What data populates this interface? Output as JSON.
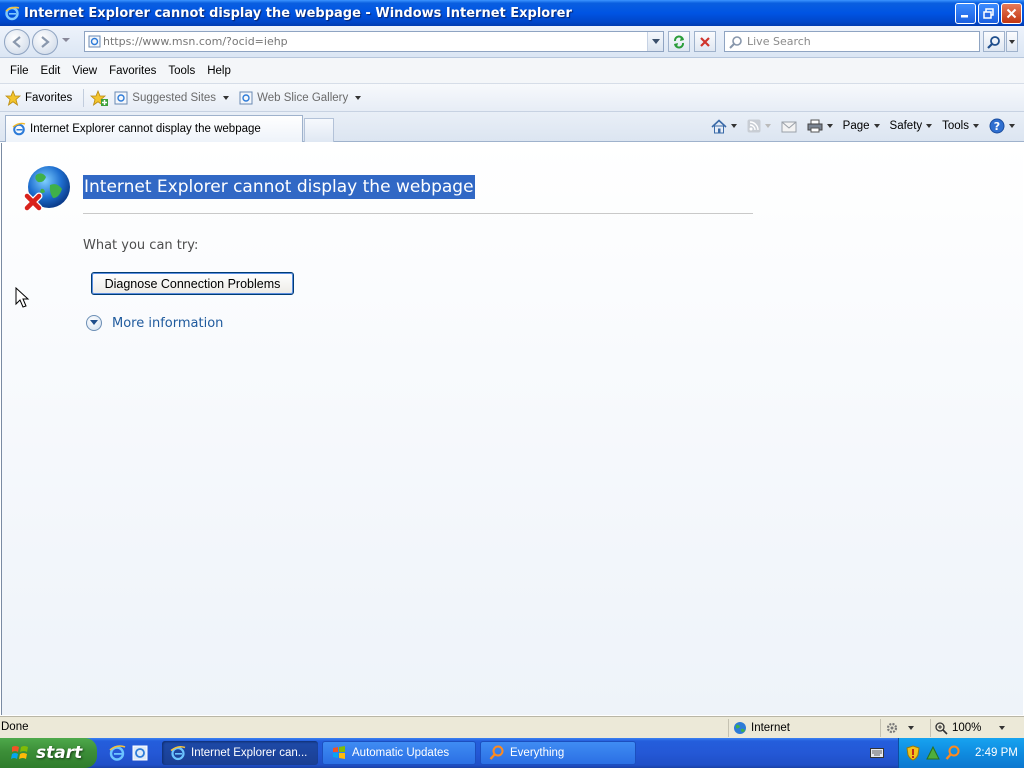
{
  "window": {
    "title": "Internet Explorer cannot display the webpage - Windows Internet Explorer"
  },
  "address_bar": {
    "url": "https://www.msn.com/?ocid=iehp",
    "search_placeholder": "Live Search"
  },
  "menu": {
    "items": [
      "File",
      "Edit",
      "View",
      "Favorites",
      "Tools",
      "Help"
    ]
  },
  "favorites_bar": {
    "favorites_label": "Favorites",
    "links": [
      "Suggested Sites",
      "Web Slice Gallery"
    ]
  },
  "tabs": {
    "active_title": "Internet Explorer cannot display the webpage"
  },
  "command_bar": {
    "page_label": "Page",
    "safety_label": "Safety",
    "tools_label": "Tools"
  },
  "page": {
    "heading": "Internet Explorer cannot display the webpage",
    "try_label": "What you can try:",
    "diagnose_button": "Diagnose Connection Problems",
    "more_info": "More information"
  },
  "status_bar": {
    "status": "Done",
    "zone": "Internet",
    "zoom": "100%"
  },
  "taskbar": {
    "start_label": "start",
    "tasks": [
      "Internet Explorer can...",
      "Automatic Updates",
      "Everything"
    ],
    "clock": "2:49 PM"
  },
  "colors": {
    "title_bar": "#0054e3",
    "selection": "#3168c5",
    "link": "#1f5a9d",
    "start_button": "#3c8e38",
    "taskbar": "#245edc"
  }
}
